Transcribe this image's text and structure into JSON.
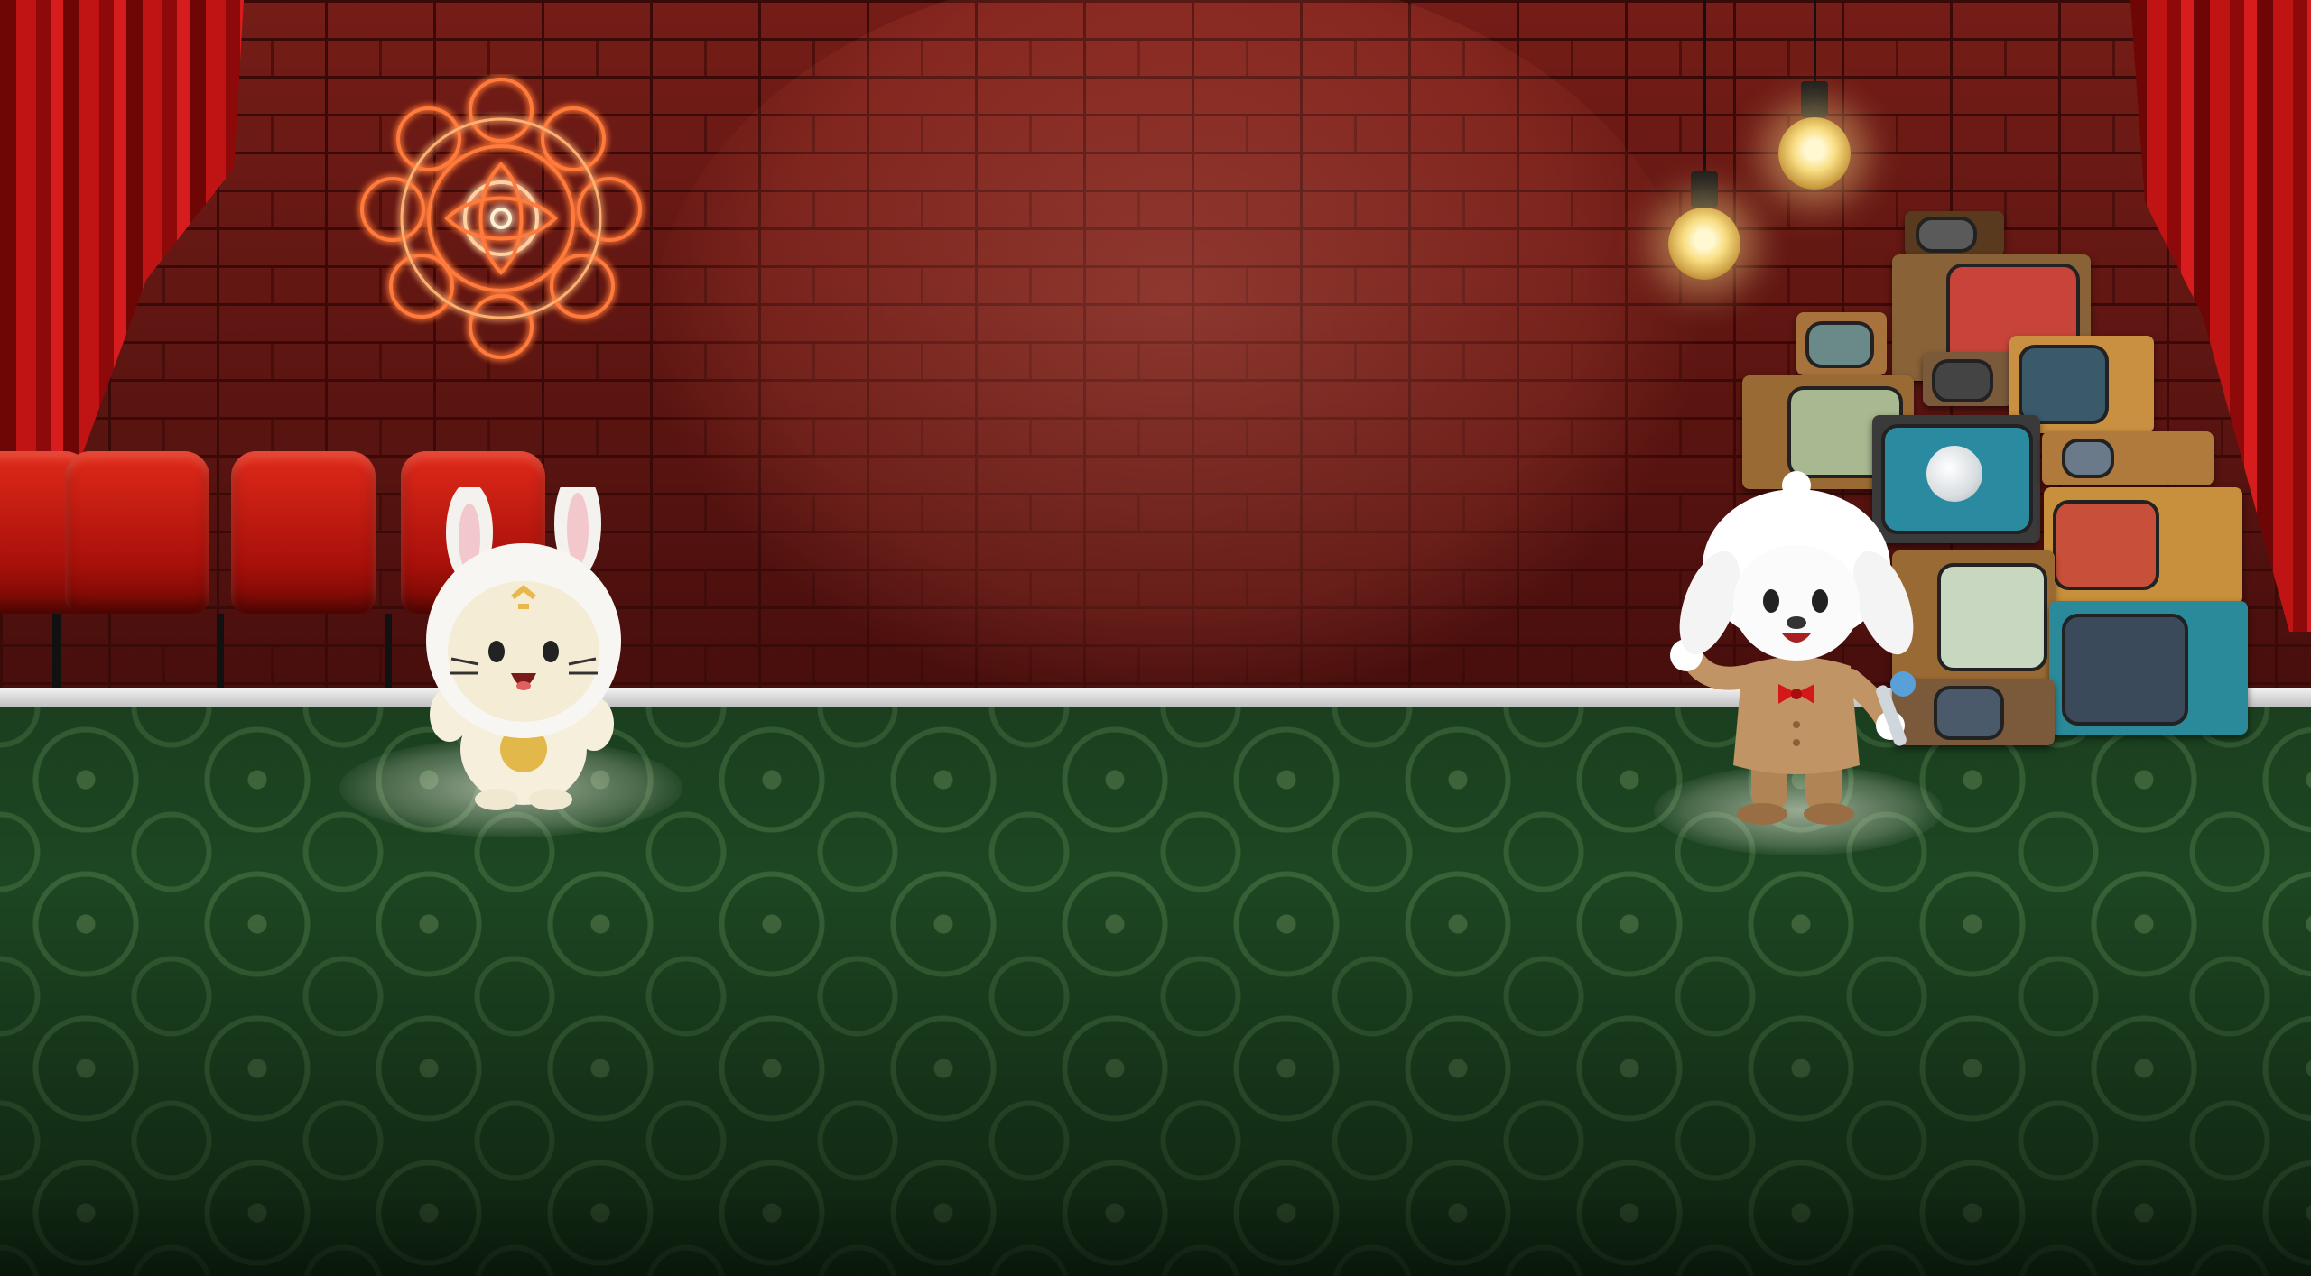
{
  "scene": {
    "name": "comedy-stage",
    "wall_color": "#5a1410",
    "floor_color": "#1f4a24",
    "curtain_color": "#c01414",
    "neon_color": "#ff5a2a"
  },
  "props": {
    "neon_sign_icon": "mooncake-neon-icon",
    "chairs_count": 4,
    "bulbs_count": 2,
    "tv_stack_icon": "retro-tv-stack"
  },
  "characters": [
    {
      "id": "cat-bunny",
      "icon": "white-cat-in-bunny-hood"
    },
    {
      "id": "sheep-host",
      "icon": "white-sheep-with-microphone"
    }
  ]
}
